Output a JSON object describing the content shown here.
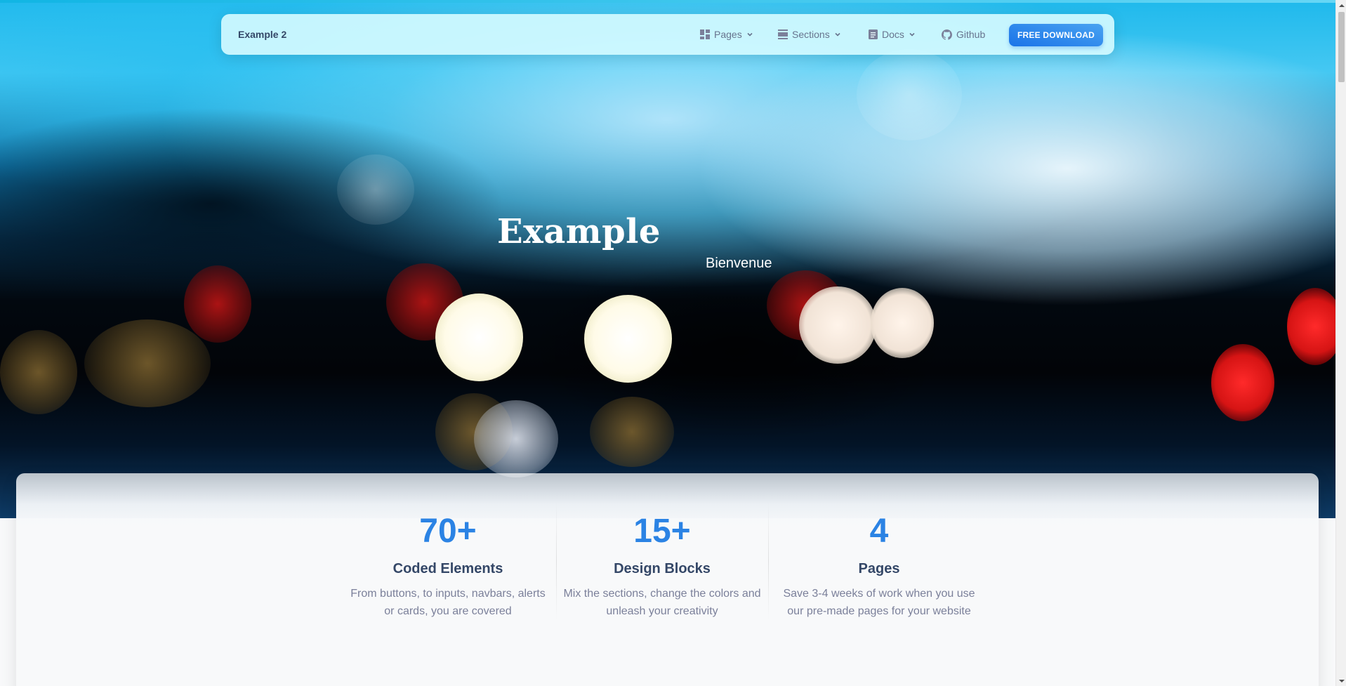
{
  "navbar": {
    "brand": "Example 2",
    "items": [
      {
        "label": "Pages",
        "icon": "dashboard-icon"
      },
      {
        "label": "Sections",
        "icon": "view-day-icon"
      },
      {
        "label": "Docs",
        "icon": "article-icon"
      },
      {
        "label": "Github",
        "icon": "github-icon"
      }
    ],
    "download_label": "FREE DOWNLOAD"
  },
  "hero": {
    "title": "Example",
    "subtitle": "Bienvenue"
  },
  "stats": [
    {
      "number": "70+",
      "title": "Coded Elements",
      "text": "From buttons, to inputs, navbars, alerts or cards, you are covered"
    },
    {
      "number": "15+",
      "title": "Design Blocks",
      "text": "Mix the sections, change the colors and unleash your creativity"
    },
    {
      "number": "4",
      "title": "Pages",
      "text": "Save 3-4 weeks of work when you use our pre-made pages for your website"
    }
  ],
  "colors": {
    "accent": "#2b83e4",
    "button": "#1a73e8",
    "heading": "#344767",
    "muted": "#7b809a"
  }
}
